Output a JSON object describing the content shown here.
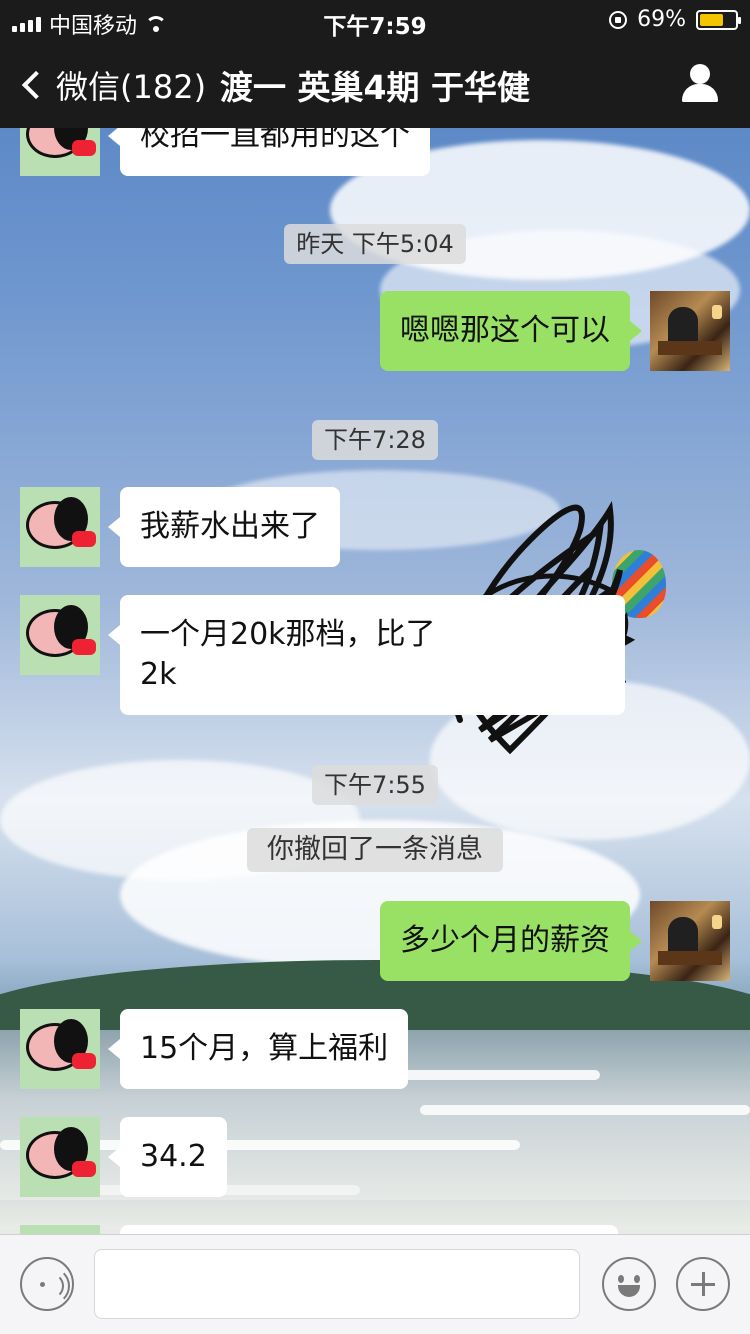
{
  "status_bar": {
    "carrier": "中国移动",
    "time": "下午7:59",
    "battery_percent": "69%",
    "battery_level": 0.69
  },
  "nav": {
    "back_label": "微信(182)",
    "title": "渡一 英巢4期 于华健"
  },
  "messages": {
    "m0": "校招一直都用的这个",
    "t1": "昨天 下午5:04",
    "m1": "嗯嗯那这个可以",
    "t2": "下午7:28",
    "m2": "我薪水出来了",
    "m3": "一个月20k那档，比了\n2k",
    "t3": "下午7:55",
    "sys1": "你撤回了一条消息",
    "m4": "多少个月的薪资",
    "m5": "15个月，算上福利",
    "m6": "34.2"
  },
  "colors": {
    "bar_dark": "#1b1b1b",
    "bubble_out": "#98e165",
    "bubble_in": "#ffffff",
    "battery": "#f5c400"
  },
  "icons": {
    "back": "chevron-left-icon",
    "profile": "person-icon",
    "voice": "voice-icon",
    "emoji": "emoji-icon",
    "more": "plus-icon"
  }
}
